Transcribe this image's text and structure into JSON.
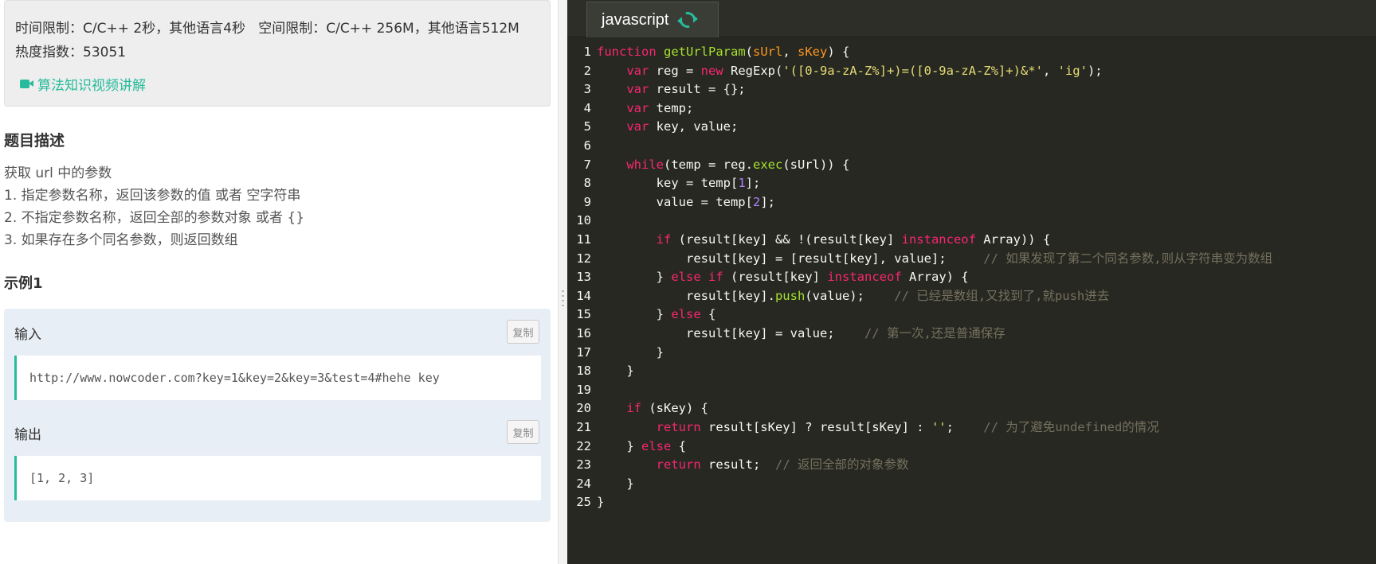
{
  "problem": {
    "time_limit": "时间限制：C/C++ 2秒，其他语言4秒",
    "space_limit": "空间限制：C/C++ 256M，其他语言512M",
    "heat": "热度指数：53051",
    "video_link": "算法知识视频讲解",
    "desc_title": "题目描述",
    "desc_lines": [
      "获取 url 中的参数",
      "1. 指定参数名称，返回该参数的值 或者 空字符串",
      "2. 不指定参数名称，返回全部的参数对象 或者 {}",
      "3. 如果存在多个同名参数，则返回数组"
    ],
    "example_title": "示例1",
    "example": {
      "input_label": "输入",
      "input_value": "http://www.nowcoder.com?key=1&key=2&key=3&test=4#hehe key",
      "output_label": "输出",
      "output_value": "[1, 2, 3]",
      "copy_label": "复制"
    }
  },
  "editor": {
    "language_tab": "javascript",
    "colors": {
      "background": "#272822",
      "keyword": "#f92672",
      "function": "#a6e22e",
      "string": "#e6db74",
      "comment": "#75715e",
      "accent": "#25bb9b"
    },
    "lines": [
      [
        [
          "kw",
          "function"
        ],
        [
          "pl",
          " "
        ],
        [
          "fn",
          "getUrlParam"
        ],
        [
          "pl",
          "("
        ],
        [
          "var",
          "sUrl"
        ],
        [
          "pl",
          ", "
        ],
        [
          "var",
          "sKey"
        ],
        [
          "pl",
          ") {"
        ]
      ],
      [
        [
          "pl",
          "    "
        ],
        [
          "kw",
          "var"
        ],
        [
          "pl",
          " reg = "
        ],
        [
          "kw",
          "new"
        ],
        [
          "pl",
          " RegExp("
        ],
        [
          "str",
          "'([0-9a-zA-Z%]+)=([0-9a-zA-Z%]+)&*'"
        ],
        [
          "pl",
          ", "
        ],
        [
          "str",
          "'ig'"
        ],
        [
          "pl",
          ");"
        ]
      ],
      [
        [
          "pl",
          "    "
        ],
        [
          "kw",
          "var"
        ],
        [
          "pl",
          " result = {};"
        ]
      ],
      [
        [
          "pl",
          "    "
        ],
        [
          "kw",
          "var"
        ],
        [
          "pl",
          " temp;"
        ]
      ],
      [
        [
          "pl",
          "    "
        ],
        [
          "kw",
          "var"
        ],
        [
          "pl",
          " key, value;"
        ]
      ],
      [
        [
          "pl",
          ""
        ]
      ],
      [
        [
          "pl",
          "    "
        ],
        [
          "kw",
          "while"
        ],
        [
          "pl",
          "(temp = reg."
        ],
        [
          "fn",
          "exec"
        ],
        [
          "pl",
          "(sUrl)) {"
        ]
      ],
      [
        [
          "pl",
          "        key = temp["
        ],
        [
          "num",
          "1"
        ],
        [
          "pl",
          "];"
        ]
      ],
      [
        [
          "pl",
          "        value = temp["
        ],
        [
          "num",
          "2"
        ],
        [
          "pl",
          "];"
        ]
      ],
      [
        [
          "pl",
          ""
        ]
      ],
      [
        [
          "pl",
          "        "
        ],
        [
          "kw",
          "if"
        ],
        [
          "pl",
          " (result[key] && !(result[key] "
        ],
        [
          "kw",
          "instanceof"
        ],
        [
          "pl",
          " Array)) {"
        ]
      ],
      [
        [
          "pl",
          "            result[key] = [result[key], value];     "
        ],
        [
          "cm",
          "// 如果发现了第二个同名参数,则从字符串变为数组"
        ]
      ],
      [
        [
          "pl",
          "        } "
        ],
        [
          "kw",
          "else"
        ],
        [
          "pl",
          " "
        ],
        [
          "kw",
          "if"
        ],
        [
          "pl",
          " (result[key] "
        ],
        [
          "kw",
          "instanceof"
        ],
        [
          "pl",
          " Array) {"
        ]
      ],
      [
        [
          "pl",
          "            result[key]."
        ],
        [
          "fn",
          "push"
        ],
        [
          "pl",
          "(value);    "
        ],
        [
          "cm",
          "// 已经是数组,又找到了,就push进去"
        ]
      ],
      [
        [
          "pl",
          "        } "
        ],
        [
          "kw",
          "else"
        ],
        [
          "pl",
          " {"
        ]
      ],
      [
        [
          "pl",
          "            result[key] = value;    "
        ],
        [
          "cm",
          "// 第一次,还是普通保存"
        ]
      ],
      [
        [
          "pl",
          "        }"
        ]
      ],
      [
        [
          "pl",
          "    }"
        ]
      ],
      [
        [
          "pl",
          ""
        ]
      ],
      [
        [
          "pl",
          "    "
        ],
        [
          "kw",
          "if"
        ],
        [
          "pl",
          " (sKey) {"
        ]
      ],
      [
        [
          "pl",
          "        "
        ],
        [
          "kw",
          "return"
        ],
        [
          "pl",
          " result[sKey] ? result[sKey] : "
        ],
        [
          "str",
          "''"
        ],
        [
          "pl",
          ";    "
        ],
        [
          "cm",
          "// 为了避免undefined的情况"
        ]
      ],
      [
        [
          "pl",
          "    } "
        ],
        [
          "kw",
          "else"
        ],
        [
          "pl",
          " {"
        ]
      ],
      [
        [
          "pl",
          "        "
        ],
        [
          "kw",
          "return"
        ],
        [
          "pl",
          " result;  "
        ],
        [
          "cm",
          "// 返回全部的对象参数"
        ]
      ],
      [
        [
          "pl",
          "    }"
        ]
      ],
      [
        [
          "pl",
          "}"
        ]
      ]
    ]
  }
}
